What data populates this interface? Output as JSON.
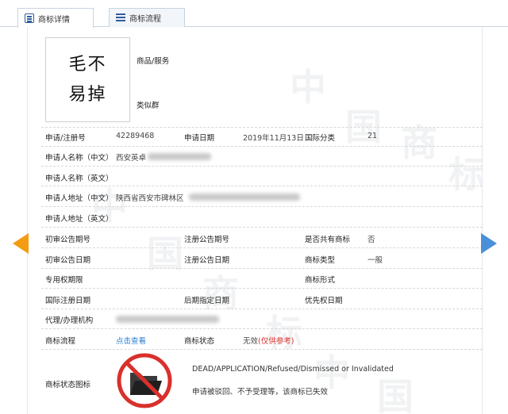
{
  "tabs": [
    {
      "label": "商标详情",
      "icon": "document-icon",
      "active": true
    },
    {
      "label": "商标流程",
      "icon": "list-icon",
      "active": false
    }
  ],
  "logo_text": [
    "毛不",
    "易掉"
  ],
  "watermark": "中国商标",
  "fields": {
    "goods_services_label": "商品/服务",
    "similar_group_label": "类似群",
    "reg_no_label": "申请/注册号",
    "reg_no": "42289468",
    "apply_date_label": "申请日期",
    "apply_date": "2019年11月13日",
    "intl_class_label": "国际分类",
    "intl_class": "21",
    "applicant_cn_label": "申请人名称（中文）",
    "applicant_cn": "西安英卓",
    "applicant_en_label": "申请人名称（英文）",
    "address_cn_label": "申请人地址（中文）",
    "address_cn": "陕西省西安市碑林区",
    "address_en_label": "申请人地址（英文）",
    "prelim_pub_no_label": "初审公告期号",
    "reg_pub_no_label": "注册公告期号",
    "shared_label": "是否共有商标",
    "shared": "否",
    "prelim_pub_date_label": "初审公告日期",
    "reg_pub_date_label": "注册公告日期",
    "tm_type_label": "商标类型",
    "tm_type": "一般",
    "exclusive_period_label": "专用权期限",
    "tm_form_label": "商标形式",
    "intl_reg_date_label": "国际注册日期",
    "later_date_label": "后期指定日期",
    "priority_date_label": "优先权日期",
    "agent_label": "代理/办理机构",
    "process_label": "商标流程",
    "process_link": "点击查看",
    "status_label": "商标状态",
    "status_value": "无效",
    "status_note": "(仅供参考)",
    "status_icon_label": "商标状态图标",
    "status_en": "DEAD/APPLICATION/Refused/Dismissed or Invalidated",
    "status_cn": "申请被驳回、不予受理等，该商标已失效"
  },
  "colors": {
    "link": "#2a7bd0",
    "note_red": "#d9302c",
    "arrow_left": "#f39c12",
    "arrow_right": "#4a90d9",
    "prohibit_red": "#d9302c"
  }
}
